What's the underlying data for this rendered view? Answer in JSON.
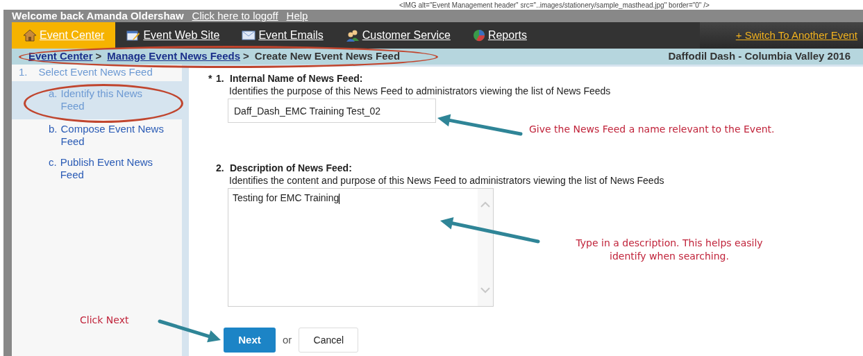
{
  "masthead_code": "<IMG alt=\"Event Management header\" src=\"..images/stationery/sample_masthead.jpg\" border=\"0\" />",
  "header": {
    "welcome": "Welcome back Amanda Oldershaw",
    "links": [
      "Click here to logoff",
      "Help"
    ]
  },
  "nav": {
    "items": [
      {
        "label": "Event Center",
        "kind": "home",
        "selected": true
      },
      {
        "label": "Event Web Site",
        "kind": "web",
        "selected": false
      },
      {
        "label": "Event Emails",
        "kind": "email",
        "selected": false
      },
      {
        "label": "Customer Service",
        "kind": "people",
        "selected": false
      },
      {
        "label": "Reports",
        "kind": "chart",
        "selected": false
      }
    ],
    "switch_link": "+ Switch To Another Event"
  },
  "breadcrumb": {
    "links": [
      "Event Center",
      "Manage Event News Feeds"
    ],
    "separator": ">",
    "current": "Create New Event News Feed",
    "event": "Daffodil Dash - Columbia Valley 2016"
  },
  "sidebar": {
    "step": {
      "number": "1.",
      "label": "Select Event News Feed"
    },
    "items": [
      {
        "marker": "a.",
        "label": "Identify this News Feed",
        "selected": true
      },
      {
        "marker": "b.",
        "label": "Compose Event News Feed",
        "selected": false
      },
      {
        "marker": "c.",
        "label": "Publish Event News Feed",
        "selected": false
      }
    ]
  },
  "form": {
    "required_mark": "*",
    "fields": [
      {
        "kind": "input",
        "required": true,
        "number": "1.",
        "label": "Internal Name of News Feed:",
        "help": "Identifies the purpose of this News Feed to administrators viewing the list of News Feeds",
        "value": "Daff_Dash_EMC Training Test_02"
      },
      {
        "kind": "textarea",
        "required": false,
        "number": "2.",
        "label": "Description of News Feed:",
        "help": "Identifies the content and purpose of this News Feed to administrators viewing the list of News Feeds",
        "value": "Testing for EMC Training"
      }
    ],
    "primary_button": "Next",
    "or_text": "or",
    "cancel_button": "Cancel"
  },
  "annotations": [
    {
      "text": "Give the News Feed a name relevant to the Event."
    },
    {
      "text": "Type in a description. This helps easily identify when searching."
    },
    {
      "text": "Click Next"
    }
  ]
}
